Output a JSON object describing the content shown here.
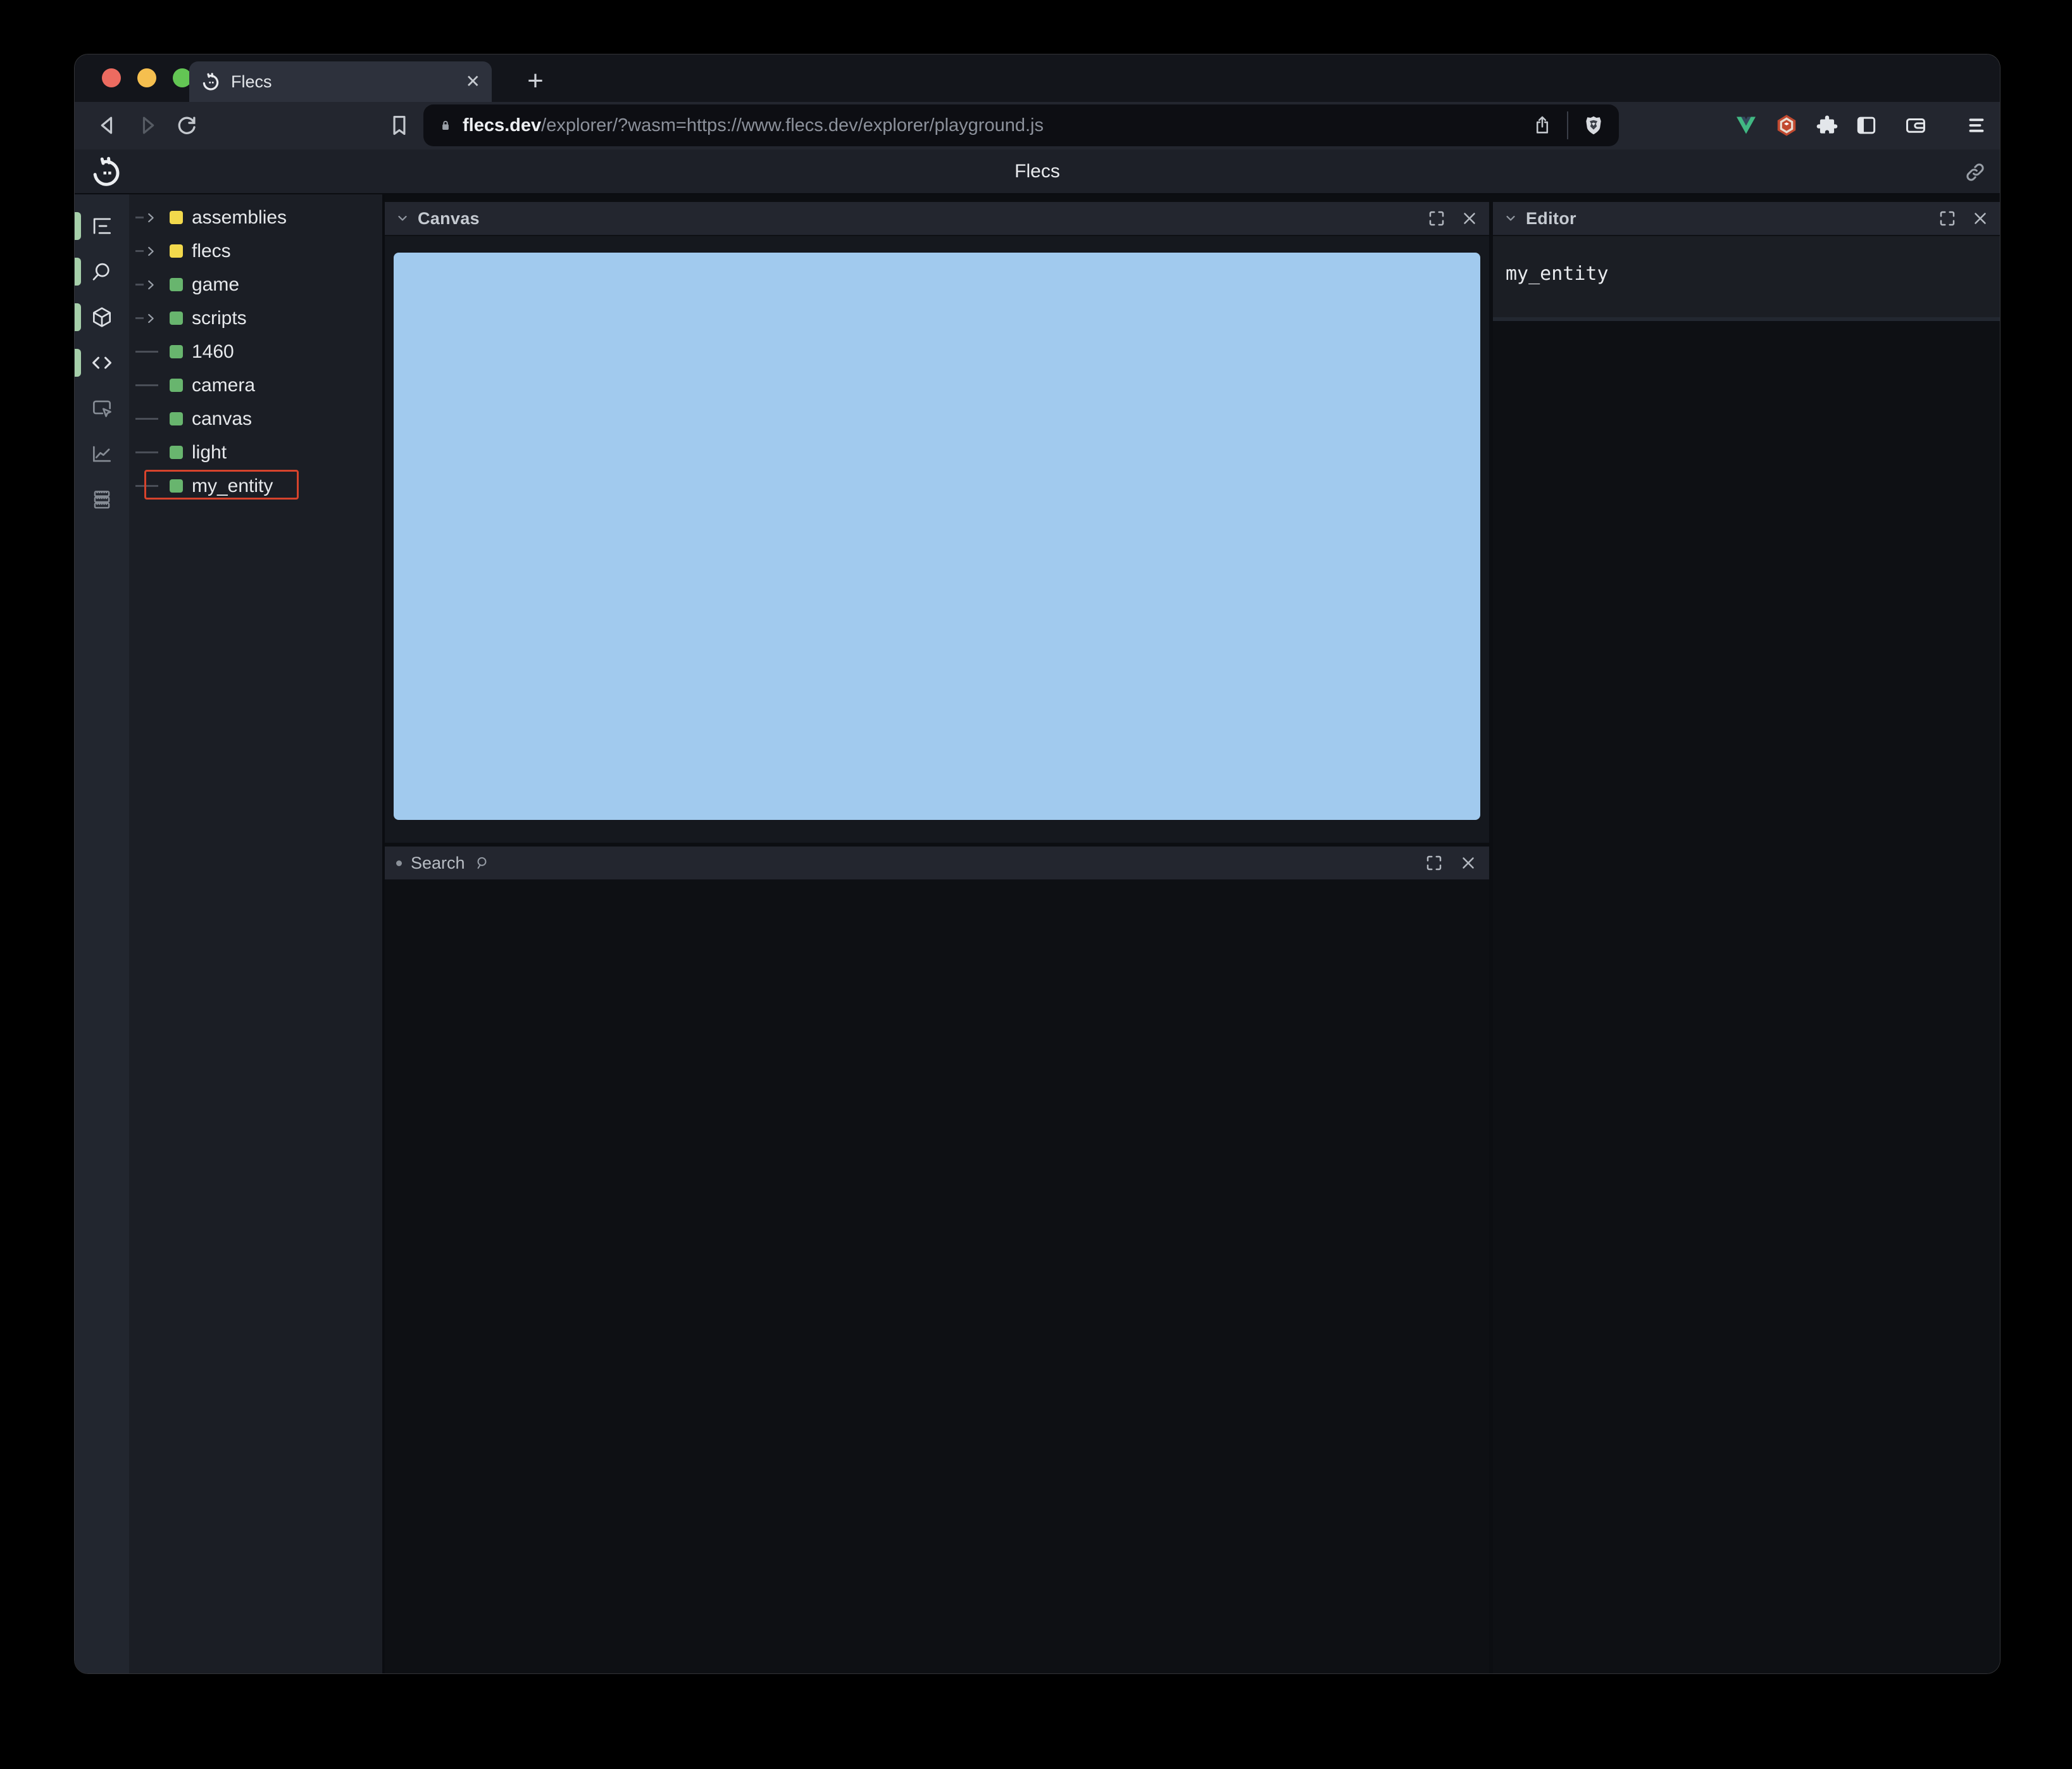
{
  "browser": {
    "tab_title": "Flecs",
    "close_tab_glyph": "✕",
    "new_tab_glyph": "+",
    "url": {
      "domain": "flecs.dev",
      "path": "/explorer/?wasm=https://www.flecs.dev/explorer/playground.js"
    }
  },
  "header": {
    "title": "Flecs"
  },
  "sidebar": {
    "icons": [
      {
        "name": "tree-view",
        "active": true
      },
      {
        "name": "search",
        "active": true
      },
      {
        "name": "entities-cube",
        "active": true
      },
      {
        "name": "code-editor",
        "active": true
      },
      {
        "name": "canvas-select",
        "active": false
      },
      {
        "name": "stats-chart",
        "active": false
      },
      {
        "name": "memory-rows",
        "active": false
      }
    ]
  },
  "tree": {
    "items": [
      {
        "label": "assemblies",
        "kind": "folder",
        "expandable": true,
        "selected": false
      },
      {
        "label": "flecs",
        "kind": "folder",
        "expandable": true,
        "selected": false
      },
      {
        "label": "game",
        "kind": "entity",
        "expandable": true,
        "selected": false
      },
      {
        "label": "scripts",
        "kind": "entity",
        "expandable": true,
        "selected": false
      },
      {
        "label": "1460",
        "kind": "entity",
        "expandable": false,
        "selected": false
      },
      {
        "label": "camera",
        "kind": "entity",
        "expandable": false,
        "selected": false
      },
      {
        "label": "canvas",
        "kind": "entity",
        "expandable": false,
        "selected": false
      },
      {
        "label": "light",
        "kind": "entity",
        "expandable": false,
        "selected": false
      },
      {
        "label": "my_entity",
        "kind": "entity",
        "expandable": false,
        "selected": true
      }
    ]
  },
  "panels": {
    "canvas": {
      "title": "Canvas"
    },
    "search": {
      "label": "Search"
    },
    "editor": {
      "title": "Editor",
      "content": "my_entity"
    }
  },
  "colors": {
    "folder": "#f2d94c",
    "entity": "#68b56e",
    "selection_red": "#d6432c",
    "canvas_blue": "#a1caee",
    "active_pill_green": "#a6cfaa",
    "traffic_red": "#ec6b60",
    "traffic_yellow": "#f5bf4f",
    "traffic_green": "#63c654"
  }
}
